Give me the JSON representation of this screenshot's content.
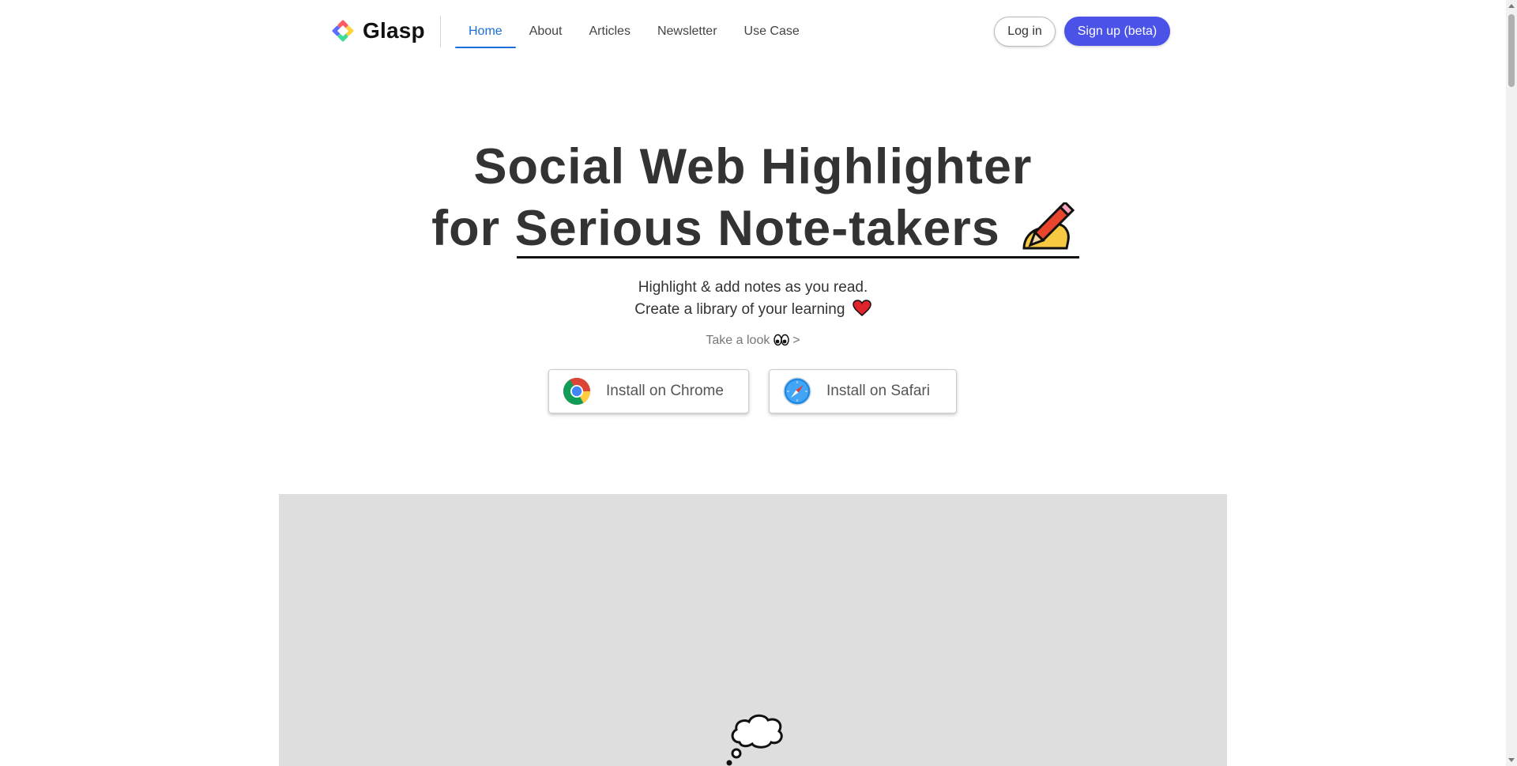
{
  "header": {
    "brand": "Glasp",
    "nav": [
      {
        "label": "Home",
        "active": true
      },
      {
        "label": "About",
        "active": false
      },
      {
        "label": "Articles",
        "active": false
      },
      {
        "label": "Newsletter",
        "active": false
      },
      {
        "label": "Use Case",
        "active": false
      }
    ],
    "login_label": "Log in",
    "signup_label": "Sign up (beta)"
  },
  "hero": {
    "title_line1": "Social Web Highlighter",
    "title_line2_prefix": "for ",
    "title_line2_highlight": "Serious Note-takers",
    "subtitle_line1": "Highlight & add notes as you read.",
    "subtitle_line2": "Create a library of your learning",
    "take_look": "Take a look",
    "take_look_arrow": ">",
    "install_chrome": "Install on Chrome",
    "install_safari": "Install on Safari"
  },
  "icons": {
    "logo": "glasp-logo-icon",
    "writing": "writing-hand-icon",
    "heart": "heart-icon",
    "eyes": "eyes-icon",
    "chrome": "chrome-icon",
    "safari": "safari-icon",
    "thought": "thought-bubble-icon"
  },
  "colors": {
    "accent": "#1a6fd8",
    "signup_bg": "#4a52e8",
    "media_bg": "#dedede"
  }
}
